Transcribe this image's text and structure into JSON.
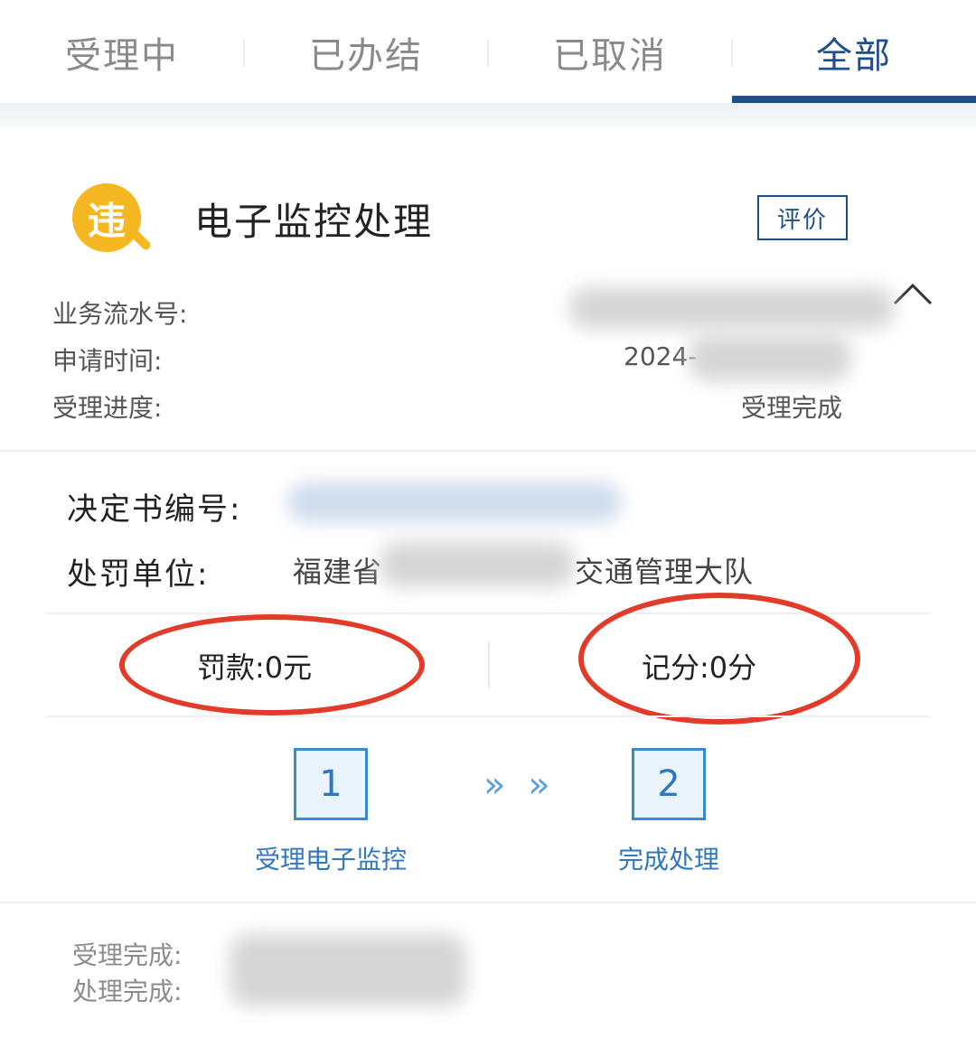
{
  "tabs": [
    {
      "label": "受理中",
      "active": false
    },
    {
      "label": "已办结",
      "active": false
    },
    {
      "label": "已取消",
      "active": false
    },
    {
      "label": "全部",
      "active": true
    }
  ],
  "card": {
    "badge_char": "违",
    "title": "电子监控处理",
    "rate_button": "评价",
    "info": {
      "serial_label": "业务流水号:",
      "time_label": "申请时间:",
      "time_value_visible": "2024-",
      "progress_label": "受理进度:",
      "progress_value": "受理完成"
    },
    "detail": {
      "decision_label": "决定书编号:",
      "unit_label": "处罚单位:",
      "unit_prefix": "福建省",
      "unit_suffix": "交通管理大队"
    },
    "stats": {
      "fine": "罚款:0元",
      "points": "记分:0分"
    },
    "steps": [
      {
        "number": "1",
        "label": "受理电子监控"
      },
      {
        "number": "2",
        "label": "完成处理"
      }
    ],
    "step_arrow": "» »",
    "footer": {
      "accepted_label": "受理完成:",
      "processed_label": "处理完成:"
    }
  },
  "colors": {
    "accent": "#1f4e8c",
    "step_blue": "#2f78bf",
    "badge": "#f5b820",
    "annotation_red": "#e23b2a"
  }
}
